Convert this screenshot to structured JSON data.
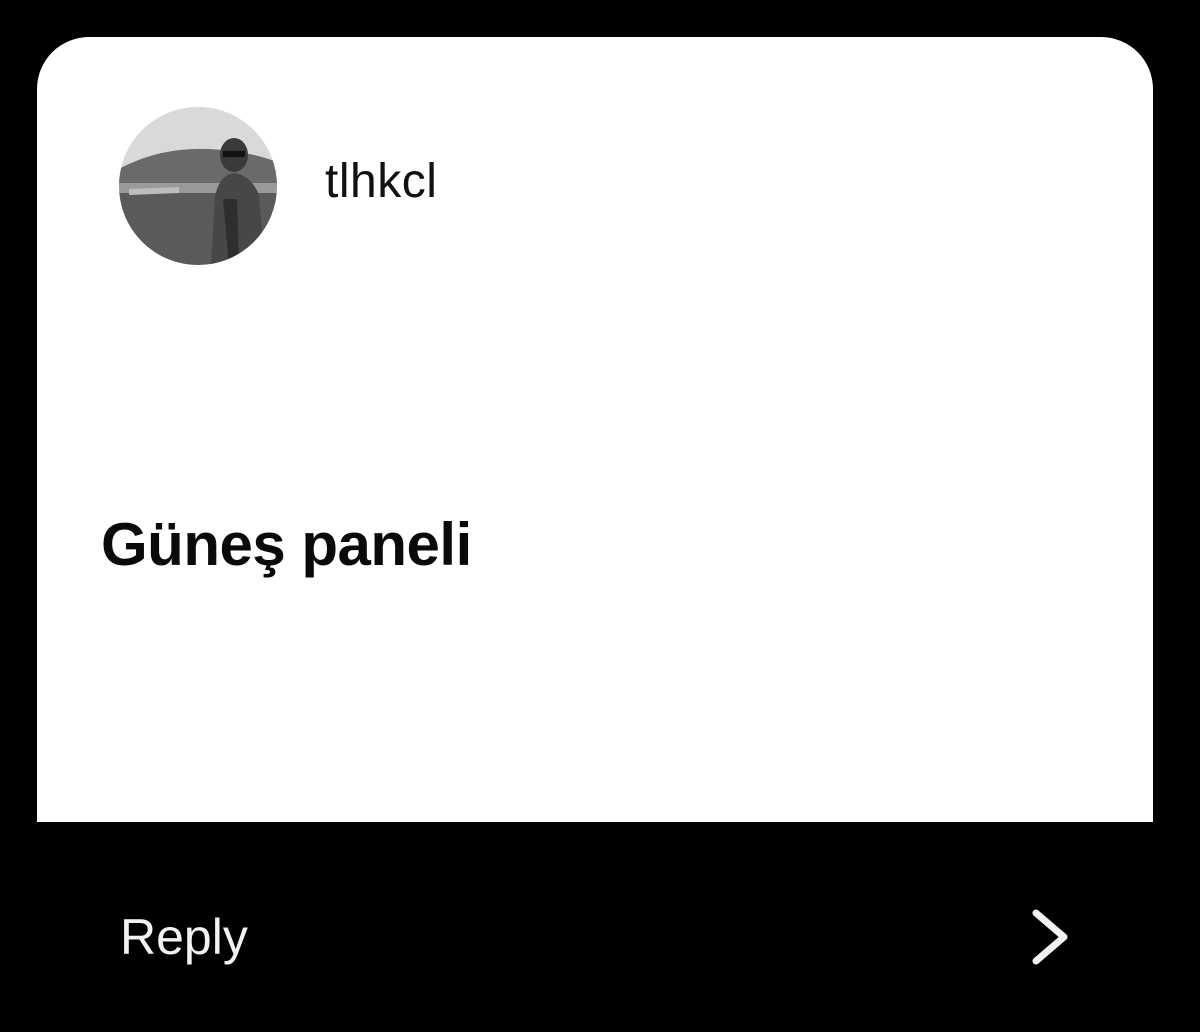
{
  "post": {
    "username": "tlhkcl",
    "avatar_icon": "profile-photo",
    "message": "Güneş paneli"
  },
  "reply": {
    "label": "Reply",
    "icon": "chevron-right-icon"
  },
  "colors": {
    "background": "#000000",
    "card": "#ffffff",
    "text_dark": "#111111",
    "text_light": "#f2f2f2"
  }
}
